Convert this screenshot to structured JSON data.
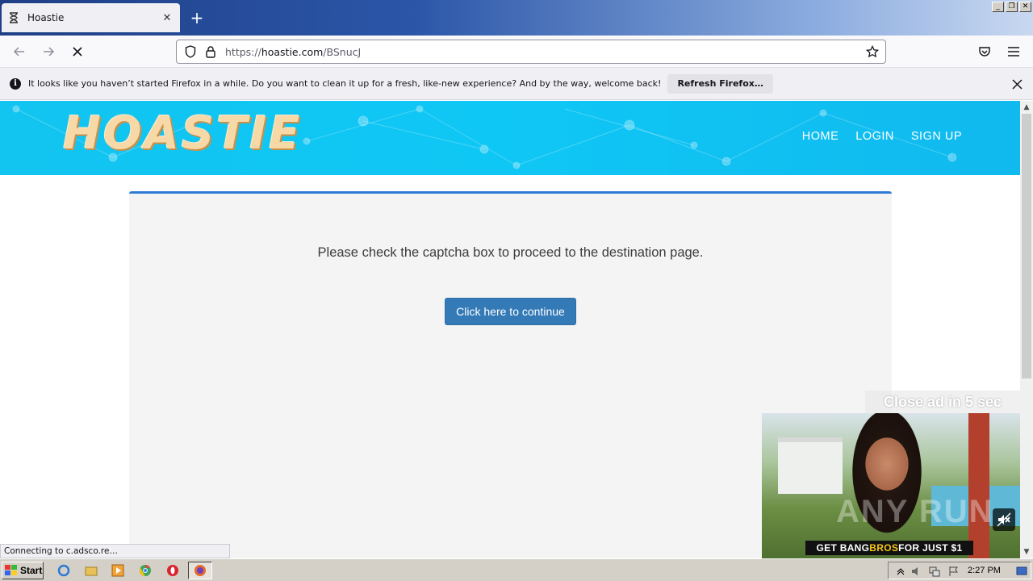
{
  "browser": {
    "tab": {
      "title": "Hoastie",
      "favicon": "hourglass-icon"
    },
    "url": {
      "prefix": "https://",
      "domain": "hoastie.com",
      "path": "/BSnucJ"
    },
    "notification": {
      "message": "It looks like you haven’t started Firefox in a while. Do you want to clean it up for a fresh, like-new experience? And by the way, welcome back!",
      "button": "Refresh Firefox…"
    },
    "status_text": "Connecting to c.adsco.re…"
  },
  "site": {
    "logo": "HOASTIE",
    "nav": [
      {
        "label": "HOME"
      },
      {
        "label": "LOGIN"
      },
      {
        "label": "SIGN UP"
      }
    ],
    "message": "Please check the captcha box to proceed to the destination page.",
    "continue_button": "Click here to continue"
  },
  "ad": {
    "close_text": "Close ad in 5 sec",
    "banner_white": "GET BANG",
    "banner_yellow": "BROS",
    "banner_white2": " FOR JUST $1",
    "watermark": "ANY RUN"
  },
  "taskbar": {
    "start_label": "Start",
    "clock": "2:27 PM"
  },
  "colors": {
    "hero_bg": "#12c4f0",
    "button_bg": "#337ab7",
    "panel_border": "#2e7bd6"
  }
}
